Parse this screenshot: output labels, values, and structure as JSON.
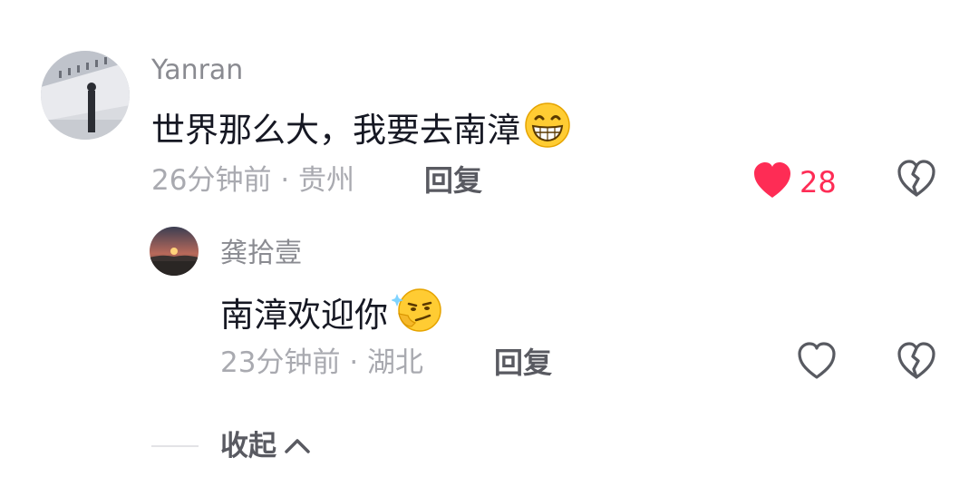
{
  "comment": {
    "username": "Yanran",
    "text": "世界那么大，我要去南漳",
    "emoji": "grinning-face-emoji",
    "time": "26分钟前",
    "separator": "·",
    "location": "贵州",
    "reply_label": "回复",
    "likes": "28",
    "liked": true,
    "like_color": "#fe2c55"
  },
  "reply": {
    "username": "龚拾壹",
    "text": "南漳欢迎你",
    "emoji": "thinking-smirk-emoji",
    "time": "23分钟前",
    "separator": "·",
    "location": "湖北",
    "reply_label": "回复",
    "liked": false
  },
  "collapse": {
    "label": "收起"
  }
}
